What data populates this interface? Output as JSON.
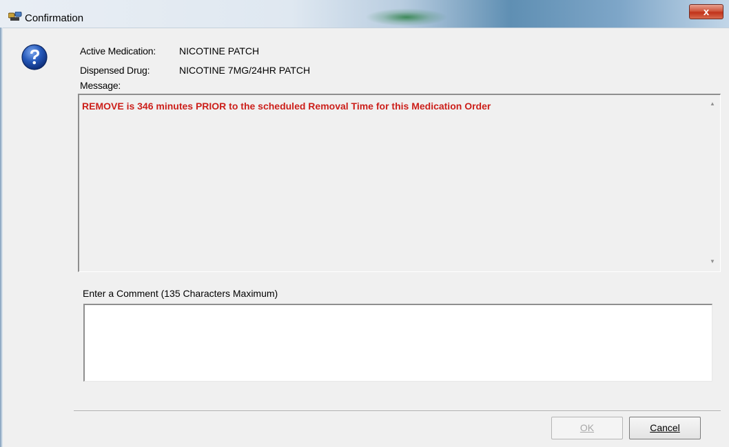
{
  "window": {
    "title": "Confirmation",
    "close_label": "x"
  },
  "fields": {
    "active_medication_label": "Active Medication:",
    "active_medication_value": "NICOTINE PATCH",
    "dispensed_drug_label": "Dispensed Drug:",
    "dispensed_drug_value": "NICOTINE 7MG/24HR PATCH",
    "message_label": "Message:"
  },
  "message": {
    "text": "REMOVE is 346 minutes PRIOR to the scheduled Removal Time for this Medication Order",
    "color": "#cc1f1a"
  },
  "comment": {
    "label": "Enter a Comment  (135 Characters Maximum)",
    "value": ""
  },
  "buttons": {
    "ok_label": "OK",
    "cancel_label": "Cancel"
  },
  "icons": {
    "dialog": "question-icon",
    "title": "app-icon"
  }
}
